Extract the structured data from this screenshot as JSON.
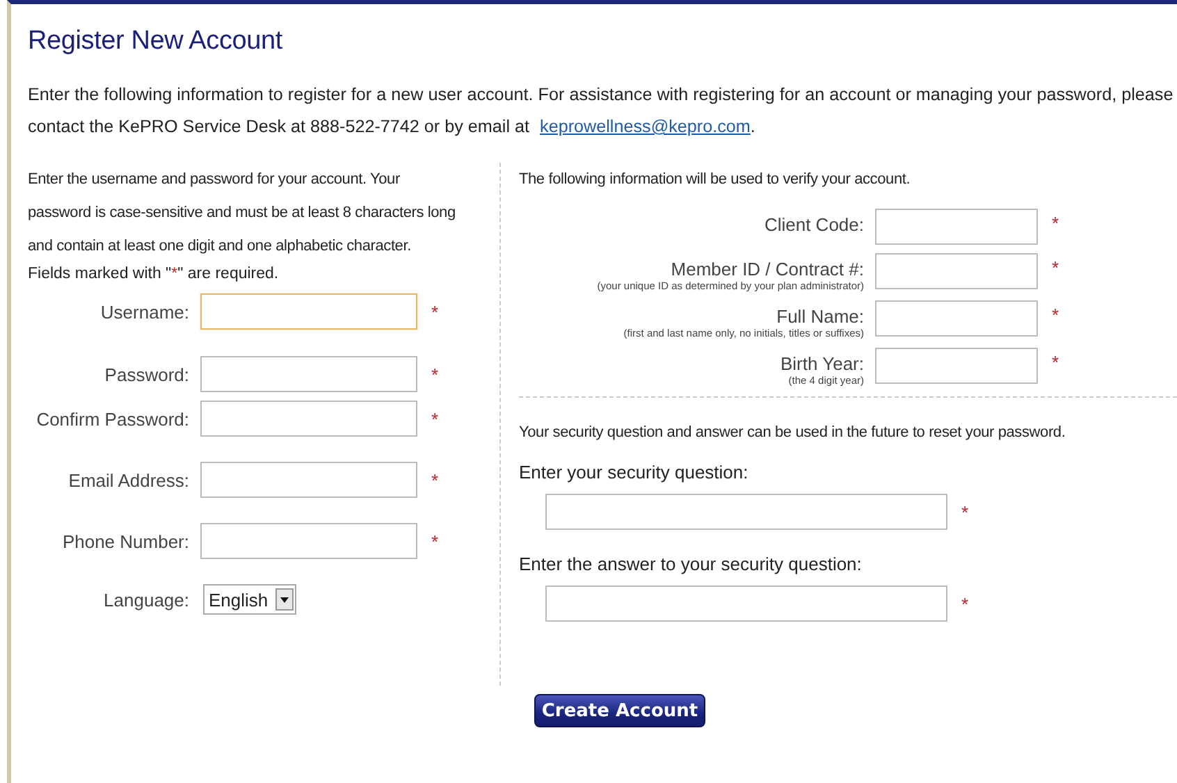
{
  "title": "Register New Account",
  "intro": {
    "text": "Enter the following information to register for a new user account. For assistance with registering for an account or managing your password, please contact the KePRO Service Desk at  888-522-7742  or by email at ",
    "email": "keprowellness@kepro.com",
    "end": "."
  },
  "account": {
    "description": "Enter the username and password for your account. Your password is case-sensitive and must be at least 8 characters long and contain at least one digit and one alphabetic character.",
    "required_note": {
      "before": "Fields marked with \"",
      "mark": "*",
      "after": "\" are required."
    },
    "fields": [
      {
        "label": "Username:",
        "mark": "*",
        "focused": true
      },
      {
        "label": "Password:",
        "mark": "*",
        "focused": false
      },
      {
        "label": "Confirm Password:",
        "mark": "*",
        "focused": false
      },
      {
        "label": "Email Address:",
        "mark": "*",
        "focused": false
      },
      {
        "label": "Phone Number:",
        "mark": "*",
        "focused": false
      }
    ],
    "language": {
      "label": "Language:",
      "value": "English"
    }
  },
  "verify": {
    "description": "The following information will be used to verify your account.",
    "fields": [
      {
        "label": "Client Code:",
        "mark": "*"
      },
      {
        "label": "Member ID / Contract #:",
        "hint": "(your unique ID as determined by your plan administrator)",
        "mark": "*"
      },
      {
        "label": "Full Name:",
        "hint": "(first and last name only, no initials, titles or suffixes)",
        "mark": "*"
      },
      {
        "label": "Birth Year:",
        "hint": "(the 4 digit year)",
        "mark": "*"
      }
    ]
  },
  "security": {
    "description": "Your security question and answer can be used in the future to reset your password.",
    "fields": [
      {
        "label": "Enter your security question:",
        "mark": "*"
      },
      {
        "label": "Enter the answer to your security question:",
        "mark": "*"
      }
    ]
  },
  "submit": "Create Account"
}
